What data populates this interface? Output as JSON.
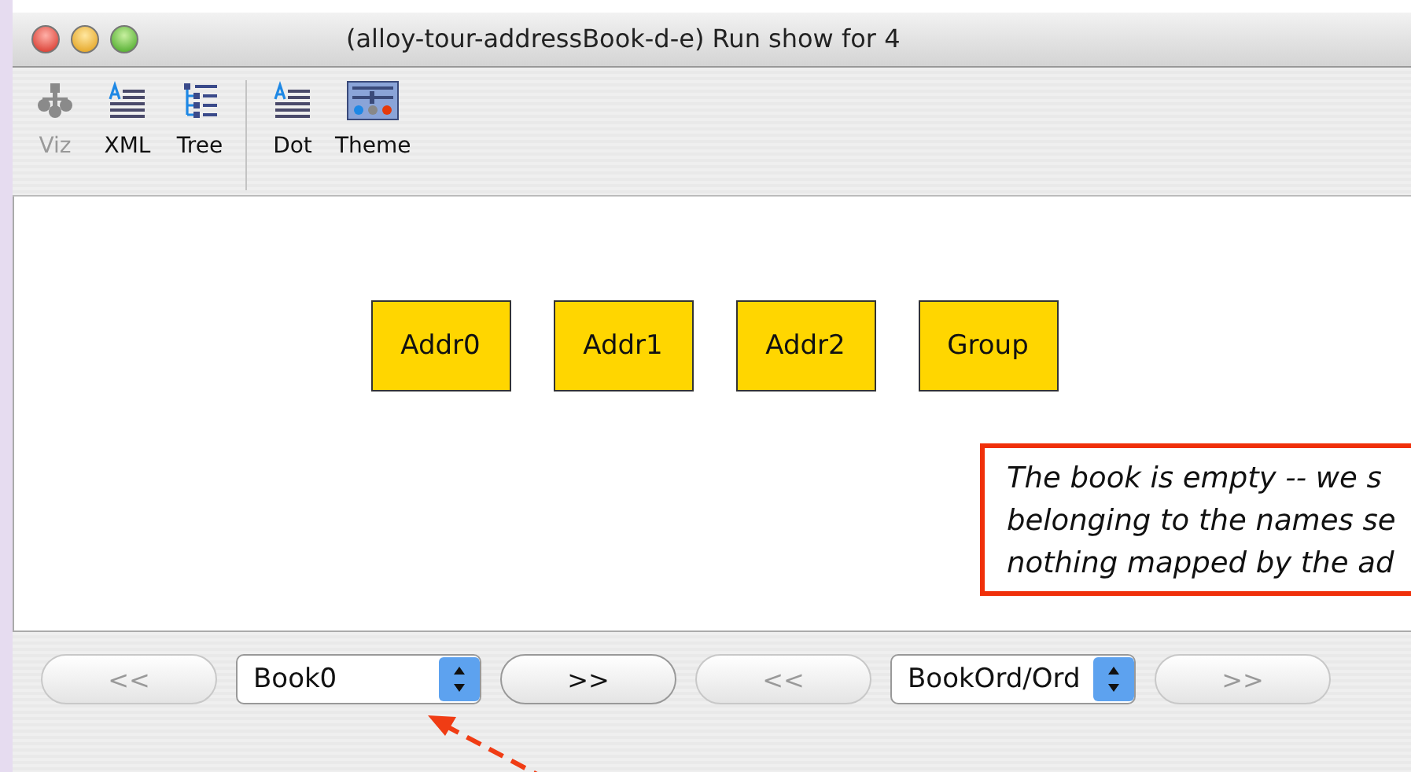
{
  "window": {
    "title": "(alloy-tour-addressBook-d-e) Run show for 4"
  },
  "toolbar": [
    {
      "label": "Viz",
      "kind": "viz",
      "disabled": true
    },
    {
      "label": "XML",
      "kind": "xml",
      "disabled": false
    },
    {
      "label": "Tree",
      "kind": "tree",
      "disabled": false
    },
    {
      "label": "Dot",
      "kind": "dot",
      "disabled": false
    },
    {
      "label": "Theme",
      "kind": "theme",
      "disabled": false
    }
  ],
  "graph": {
    "nodes": [
      "Addr0",
      "Addr1",
      "Addr2",
      "Group"
    ]
  },
  "annotation": {
    "lines": [
      "The book is empty -- we s",
      "belonging to the names se",
      "nothing mapped by the ad"
    ]
  },
  "bottom_bar": [
    {
      "kind": "button",
      "label": "<<",
      "disabled": true
    },
    {
      "kind": "dropdown",
      "value": "Book0"
    },
    {
      "kind": "button",
      "label": ">>",
      "disabled": false
    },
    {
      "kind": "button",
      "label": "<<",
      "disabled": true
    },
    {
      "kind": "dropdown",
      "value": "BookOrd/Ord"
    },
    {
      "kind": "button",
      "label": ">>",
      "disabled": true
    }
  ]
}
